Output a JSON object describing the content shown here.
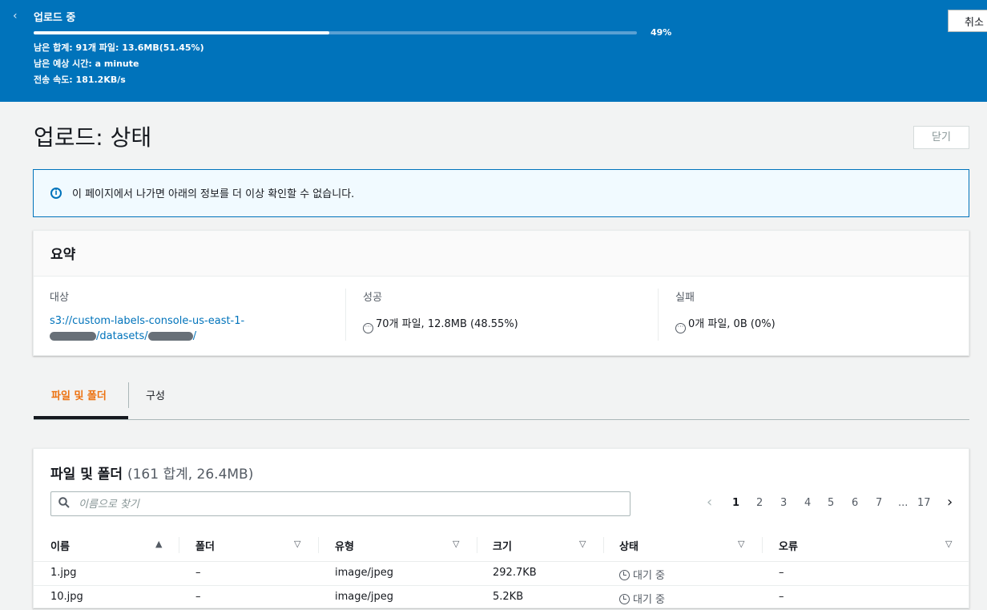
{
  "banner": {
    "title": "업로드 중",
    "progress_percent": 49,
    "percent_label": "49%",
    "remaining": "남은 합계: 91개 파일: 13.6MB(51.45%)",
    "eta": "남은 예상 시간: a minute",
    "speed": "전송 속도: 181.2KB/s",
    "cancel_label": "취소",
    "collapse_glyph": "‹"
  },
  "page": {
    "title": "업로드: 상태",
    "close_label": "닫기"
  },
  "info": {
    "icon": "info-icon",
    "text": "이 페이지에서 나가면 아래의 정보를 더 이상 확인할 수 없습니다."
  },
  "summary": {
    "heading": "요약",
    "destination_label": "대상",
    "destination_line1": "s3://custom-labels-console-us-east-1-",
    "destination_mid": "/datasets/",
    "destination_end": "/",
    "success_label": "성공",
    "success_value": "70개 파일, 12.8MB (48.55%)",
    "failed_label": "실패",
    "failed_value": "0개 파일, 0B (0%)"
  },
  "tabs": [
    {
      "label": "파일 및 폴더",
      "active": true
    },
    {
      "label": "구성",
      "active": false
    }
  ],
  "files": {
    "heading": "파일 및 폴더",
    "count": "(161 합계, 26.4MB)",
    "search_placeholder": "이름으로 찾기",
    "pages": [
      "1",
      "2",
      "3",
      "4",
      "5",
      "6",
      "7",
      "...",
      "17"
    ],
    "current_page": "1",
    "columns": [
      "이름",
      "폴더",
      "유형",
      "크기",
      "상태",
      "오류"
    ],
    "rows": [
      {
        "name": "1.jpg",
        "folder": "–",
        "type": "image/jpeg",
        "size": "292.7KB",
        "status": "대기 중",
        "error": "–"
      },
      {
        "name": "10.jpg",
        "folder": "–",
        "type": "image/jpeg",
        "size": "5.2KB",
        "status": "대기 중",
        "error": "–"
      }
    ]
  },
  "colors": {
    "banner": "#0073bb",
    "accent_tab": "#ec7211",
    "link": "#0073bb"
  }
}
